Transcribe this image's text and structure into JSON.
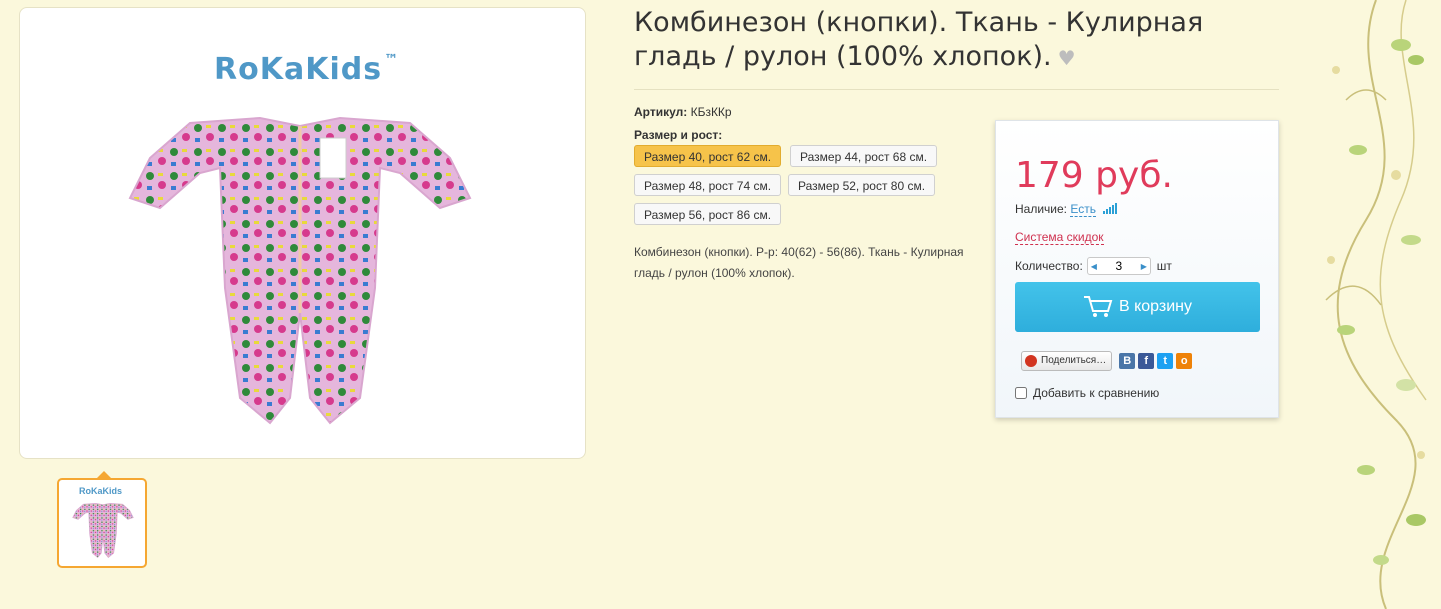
{
  "product": {
    "title": "Комбинезон (кнопки). Ткань - Кулирная гладь / рулон (100% хлопок).",
    "favorite_icon": "heart-icon",
    "article_label": "Артикул:",
    "article_value": "КБзККр",
    "size_label": "Размер и рост:",
    "sizes": [
      {
        "label": "Размер 40, рост 62 см.",
        "selected": true
      },
      {
        "label": "Размер 44, рост 68 см.",
        "selected": false
      },
      {
        "label": "Размер 48, рост 74 см.",
        "selected": false
      },
      {
        "label": "Размер 52, рост 80 см.",
        "selected": false
      },
      {
        "label": "Размер 56, рост 86 см.",
        "selected": false
      }
    ],
    "description": "Комбинезон (кнопки). Р-р: 40(62) - 56(86). Ткань - Кулирная гладь / рулон (100% хлопок).",
    "image_logo": "RoKaKids",
    "image_logo_tm": "™",
    "thumb_logo": "RoKaKids"
  },
  "buybox": {
    "price": "179 руб.",
    "stock_label": "Наличие:",
    "stock_value": "Есть",
    "discount_link": "Система скидок",
    "qty_label": "Количество:",
    "qty_value": "3",
    "qty_unit": "шт",
    "cart_label": "В корзину",
    "share_label": "Поделиться…",
    "compare_label": "Добавить к сравнению"
  },
  "colors": {
    "background": "#fbf8dc",
    "price": "#e03b5b",
    "cart_button": "#36b6e2",
    "active_size": "#f6c34a",
    "thumb_border": "#f5a732"
  }
}
